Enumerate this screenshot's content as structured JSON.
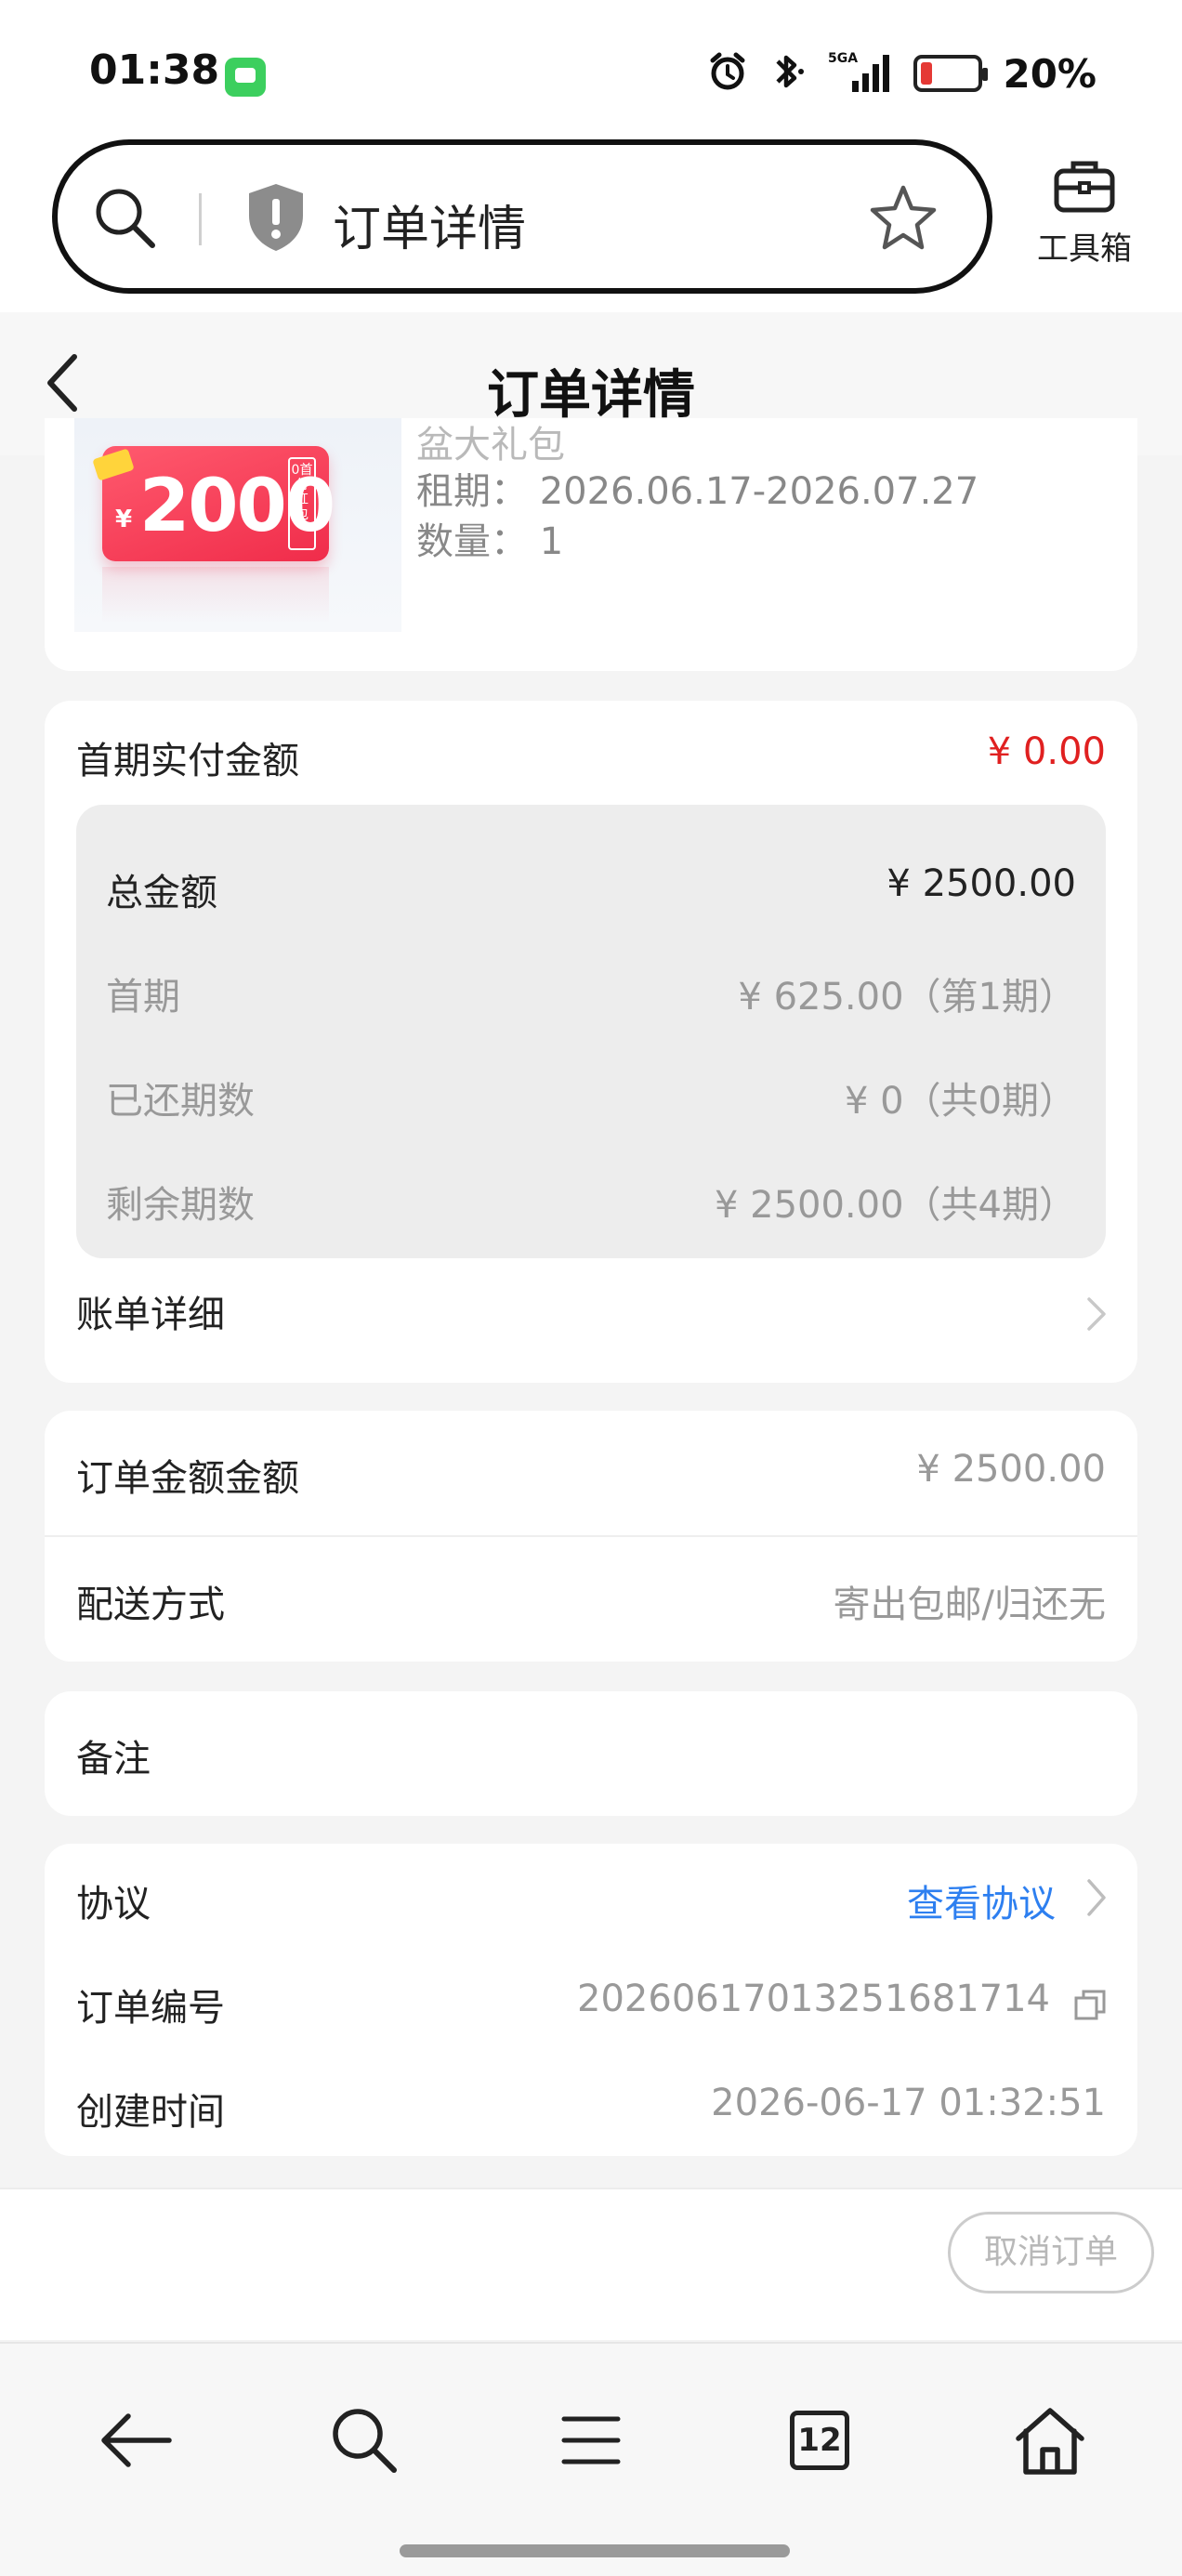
{
  "status_bar": {
    "time": "01:38",
    "network": "5GA",
    "battery_percent": "20%",
    "battery_level": 0.2,
    "icons": [
      "messages-icon",
      "alarm-icon",
      "bluetooth-icon",
      "signal-icon",
      "battery-icon"
    ]
  },
  "browser": {
    "address_title": "订单详情",
    "toolbox_label": "工具箱",
    "icons": [
      "search-icon",
      "shield-warning-icon",
      "star-icon",
      "toolbox-icon"
    ]
  },
  "header": {
    "title": "订单详情"
  },
  "product": {
    "name_partial": "盆大礼包",
    "coupon_amount": "2000",
    "coupon_currency": "¥",
    "coupon_side_text": "0首付红包",
    "lease_line": "租期：  2026.06.17-2026.07.27",
    "quantity_line": "数量：  1"
  },
  "payment": {
    "first_pay_label": "首期实付金额",
    "first_pay_value": "¥ 0.00",
    "rows": [
      {
        "label": "总金额",
        "value": "¥ 2500.00"
      },
      {
        "label": "首期",
        "value": "¥ 625.00（第1期）"
      },
      {
        "label": "已还期数",
        "value": "¥ 0（共0期）"
      },
      {
        "label": "剩余期数",
        "value": "¥ 2500.00（共4期）"
      }
    ],
    "bill_detail_label": "账单详细"
  },
  "order": {
    "amount_label": "订单金额金额",
    "amount_value": "¥ 2500.00",
    "delivery_label": "配送方式",
    "delivery_value": "寄出包邮/归还无"
  },
  "remark": {
    "label": "备注"
  },
  "info": {
    "agreement_label": "协议",
    "agreement_link": "查看协议",
    "order_no_label": "订单编号",
    "order_no_value": "20260617013251681714",
    "created_label": "创建时间",
    "created_value": "2026-06-17 01:32:51"
  },
  "actions": {
    "cancel_label": "取消订单"
  },
  "bottom_nav": {
    "tab_count": "12",
    "icons": [
      "back-arrow-icon",
      "search-icon",
      "menu-icon",
      "tabs-icon",
      "home-icon"
    ]
  },
  "colors": {
    "accent_red": "#e02020",
    "link_blue": "#2d7ff0",
    "coupon_red": "#f02c4a"
  }
}
